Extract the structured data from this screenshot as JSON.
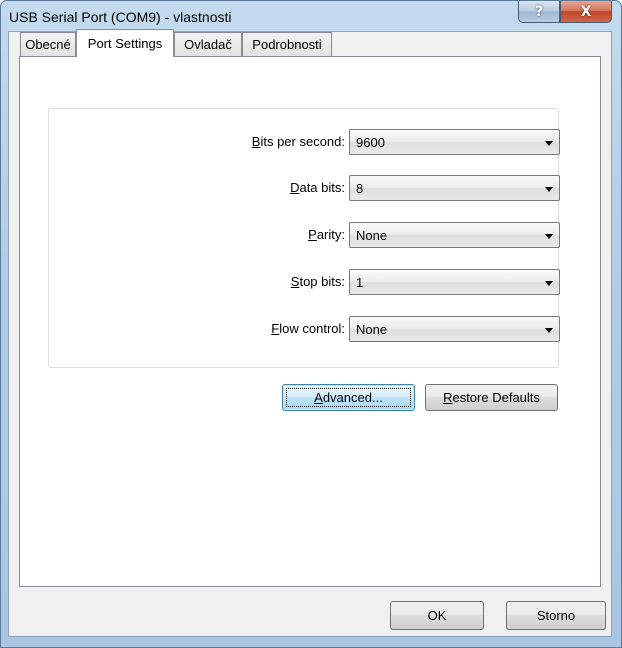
{
  "window": {
    "title": "USB Serial Port (COM9) - vlastnosti",
    "help_glyph": "?",
    "close_glyph": "X"
  },
  "tabs": [
    {
      "label": "Obecné",
      "active": false
    },
    {
      "label": "Port Settings",
      "active": true
    },
    {
      "label": "Ovladač",
      "active": false
    },
    {
      "label": "Podrobnosti",
      "active": false
    }
  ],
  "settings": [
    {
      "label_prefix": "",
      "label_access": "B",
      "label_rest": "its per second:",
      "value": "9600"
    },
    {
      "label_prefix": "",
      "label_access": "D",
      "label_rest": "ata bits:",
      "value": "8"
    },
    {
      "label_prefix": "",
      "label_access": "P",
      "label_rest": "arity:",
      "value": "None"
    },
    {
      "label_prefix": "",
      "label_access": "S",
      "label_rest": "top bits:",
      "value": "1"
    },
    {
      "label_prefix": "",
      "label_access": "F",
      "label_rest": "low control:",
      "value": "None"
    }
  ],
  "buttons": {
    "advanced_access": "A",
    "advanced_rest": "dvanced...",
    "restore_access": "R",
    "restore_rest": "estore Defaults",
    "ok": "OK",
    "cancel": "Storno"
  }
}
